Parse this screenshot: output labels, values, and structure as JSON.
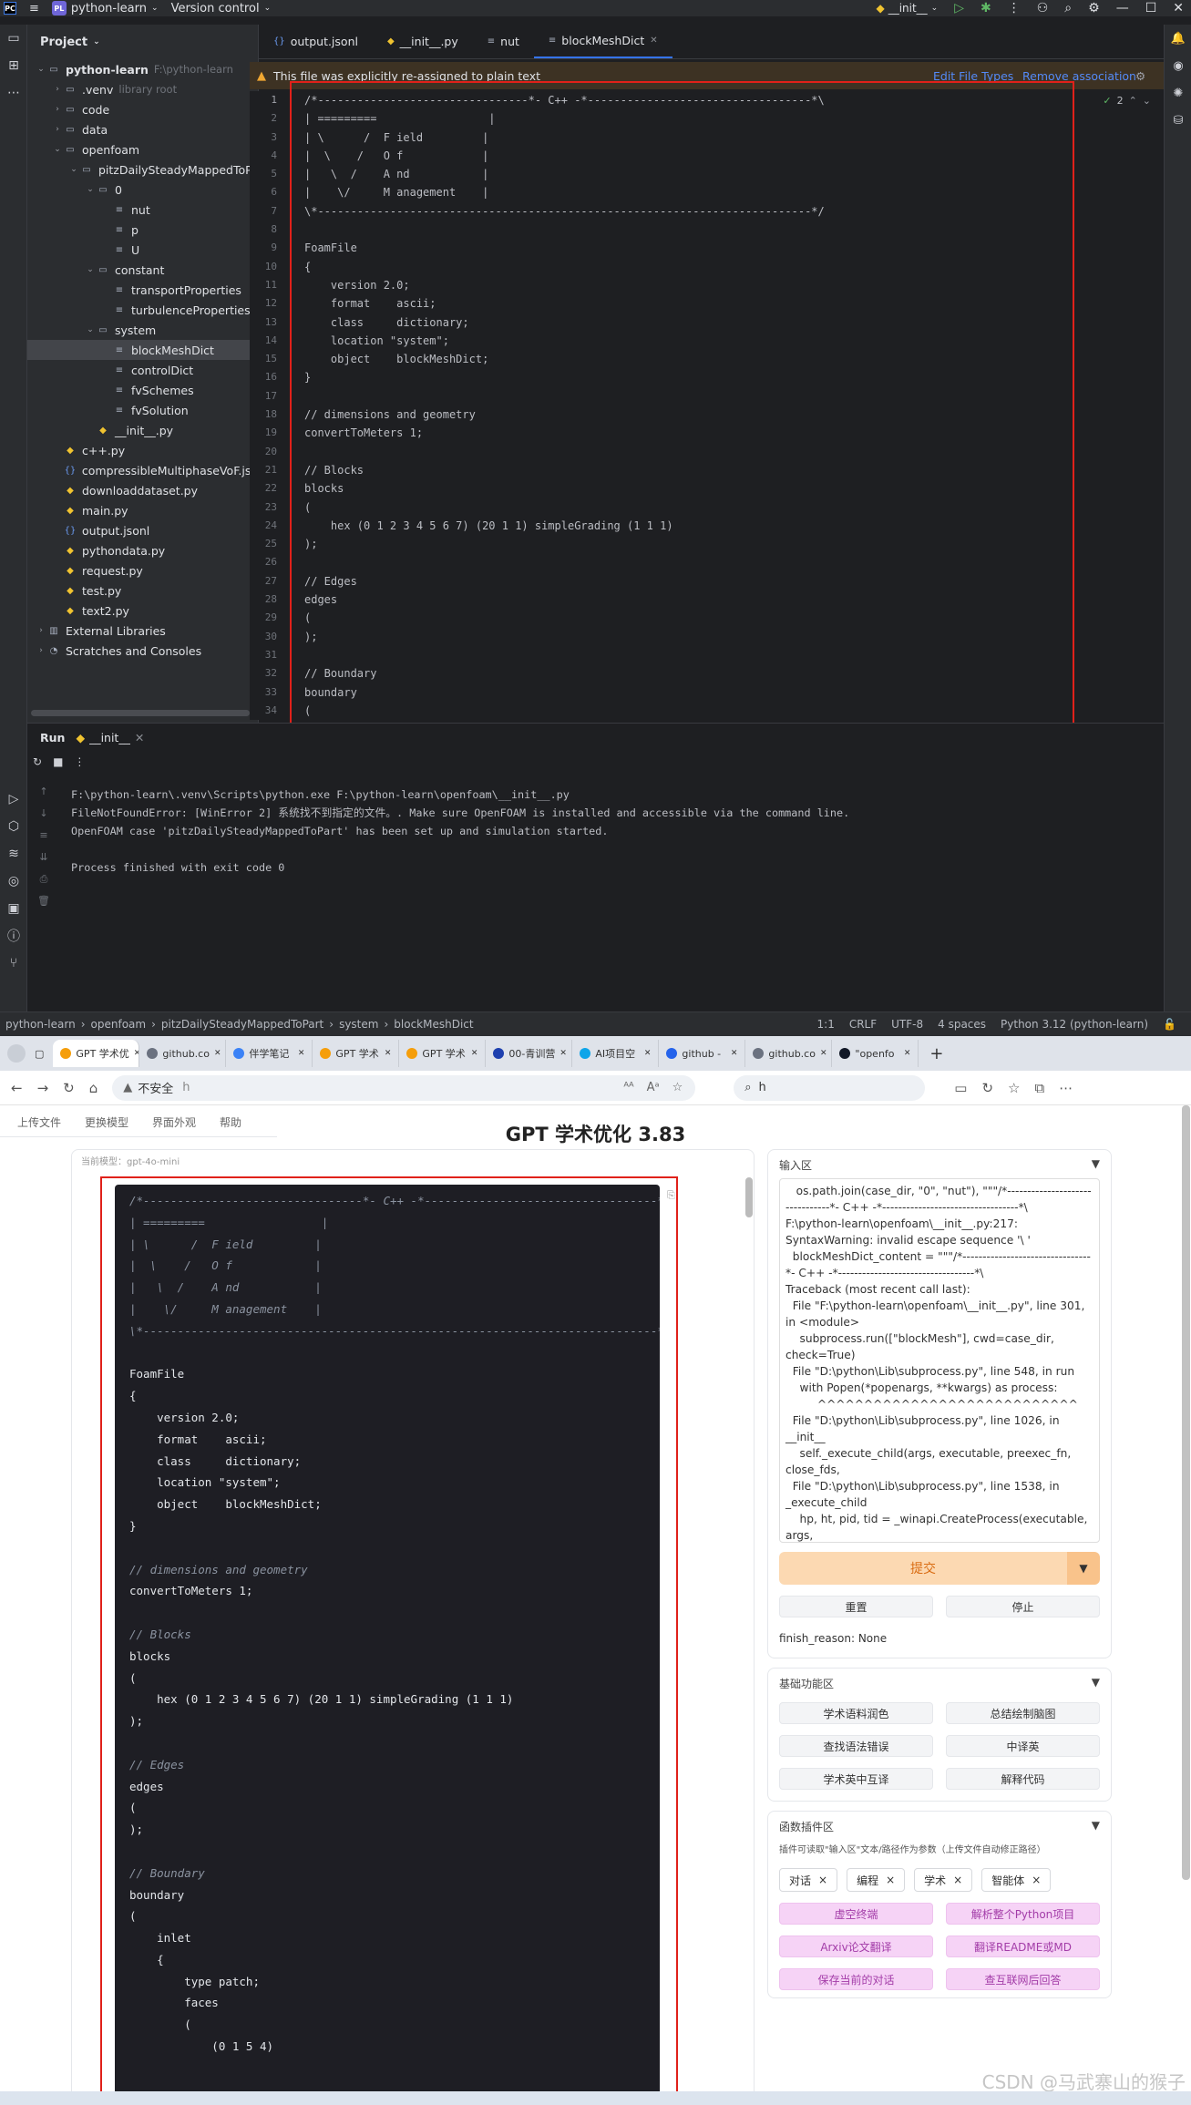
{
  "ide": {
    "title_bar": {
      "project": "python-learn",
      "vcs": "Version control",
      "run_config": "__init__"
    },
    "project_panel": {
      "title": "Project",
      "tree": [
        {
          "label": "python-learn",
          "hint": "F:\\python-learn",
          "depth": 0,
          "type": "folder",
          "open": true,
          "bold": true
        },
        {
          "label": ".venv",
          "hint": "library root",
          "depth": 1,
          "type": "folder",
          "open": false
        },
        {
          "label": "code",
          "hint": "",
          "depth": 1,
          "type": "folder",
          "open": false
        },
        {
          "label": "data",
          "hint": "",
          "depth": 1,
          "type": "folder",
          "open": false
        },
        {
          "label": "openfoam",
          "hint": "",
          "depth": 1,
          "type": "folder",
          "open": true
        },
        {
          "label": "pitzDailySteadyMappedToP",
          "hint": "",
          "depth": 2,
          "type": "folder",
          "open": true
        },
        {
          "label": "0",
          "hint": "",
          "depth": 3,
          "type": "folder",
          "open": true
        },
        {
          "label": "nut",
          "hint": "",
          "depth": 4,
          "type": "text"
        },
        {
          "label": "p",
          "hint": "",
          "depth": 4,
          "type": "text"
        },
        {
          "label": "U",
          "hint": "",
          "depth": 4,
          "type": "text"
        },
        {
          "label": "constant",
          "hint": "",
          "depth": 3,
          "type": "folder",
          "open": true
        },
        {
          "label": "transportProperties",
          "hint": "",
          "depth": 4,
          "type": "text"
        },
        {
          "label": "turbulenceProperties",
          "hint": "",
          "depth": 4,
          "type": "text"
        },
        {
          "label": "system",
          "hint": "",
          "depth": 3,
          "type": "folder",
          "open": true
        },
        {
          "label": "blockMeshDict",
          "hint": "",
          "depth": 4,
          "type": "text",
          "selected": true
        },
        {
          "label": "controlDict",
          "hint": "",
          "depth": 4,
          "type": "text"
        },
        {
          "label": "fvSchemes",
          "hint": "",
          "depth": 4,
          "type": "text"
        },
        {
          "label": "fvSolution",
          "hint": "",
          "depth": 4,
          "type": "text"
        },
        {
          "label": "__init__.py",
          "hint": "",
          "depth": 3,
          "type": "py"
        },
        {
          "label": "c++.py",
          "hint": "",
          "depth": 1,
          "type": "py"
        },
        {
          "label": "compressibleMultiphaseVoF.jso",
          "hint": "",
          "depth": 1,
          "type": "json"
        },
        {
          "label": "downloaddataset.py",
          "hint": "",
          "depth": 1,
          "type": "py"
        },
        {
          "label": "main.py",
          "hint": "",
          "depth": 1,
          "type": "py"
        },
        {
          "label": "output.jsonl",
          "hint": "",
          "depth": 1,
          "type": "json"
        },
        {
          "label": "pythondata.py",
          "hint": "",
          "depth": 1,
          "type": "py"
        },
        {
          "label": "request.py",
          "hint": "",
          "depth": 1,
          "type": "py"
        },
        {
          "label": "test.py",
          "hint": "",
          "depth": 1,
          "type": "py"
        },
        {
          "label": "text2.py",
          "hint": "",
          "depth": 1,
          "type": "py"
        },
        {
          "label": "External Libraries",
          "hint": "",
          "depth": 0,
          "type": "lib",
          "open": false
        },
        {
          "label": "Scratches and Consoles",
          "hint": "",
          "depth": 0,
          "type": "scratch",
          "open": false
        }
      ]
    },
    "editor_tabs": [
      {
        "label": "output.jsonl",
        "icon": "json-icon"
      },
      {
        "label": "__init__.py",
        "icon": "python-icon"
      },
      {
        "label": "nut",
        "icon": "text-file-icon"
      },
      {
        "label": "blockMeshDict",
        "icon": "text-file-icon",
        "active": true,
        "closable": true
      }
    ],
    "notice": {
      "text": "This file was explicitly re-assigned to plain text",
      "action1": "Edit File Types",
      "action2": "Remove association"
    },
    "editor": {
      "inspection_count": "2",
      "lines": [
        "/*--------------------------------*- C++ -*----------------------------------*\\",
        "| =========                 |",
        "| \\      /  F ield         |",
        "|  \\    /   O f            |",
        "|   \\  /    A nd           |",
        "|    \\/     M anagement    |",
        "\\*---------------------------------------------------------------------------*/",
        "",
        "FoamFile",
        "{",
        "    version 2.0;",
        "    format    ascii;",
        "    class     dictionary;",
        "    location \"system\";",
        "    object    blockMeshDict;",
        "}",
        "",
        "// dimensions and geometry",
        "convertToMeters 1;",
        "",
        "// Blocks",
        "blocks",
        "(",
        "    hex (0 1 2 3 4 5 6 7) (20 1 1) simpleGrading (1 1 1)",
        ");",
        "",
        "// Edges",
        "edges",
        "(",
        ");",
        "",
        "// Boundary",
        "boundary",
        "("
      ]
    },
    "run": {
      "tab_label": "Run",
      "config_label": "__init__",
      "output": [
        "F:\\python-learn\\.venv\\Scripts\\python.exe F:\\python-learn\\openfoam\\__init__.py",
        "FileNotFoundError: [WinError 2] 系统找不到指定的文件。. Make sure OpenFOAM is installed and accessible via the command line.",
        "OpenFOAM case 'pitzDailySteadyMappedToPart' has been set up and simulation started.",
        "",
        "Process finished with exit code 0"
      ]
    },
    "status": {
      "breadcrumb": [
        "python-learn",
        "openfoam",
        "pitzDailySteadyMappedToPart",
        "system",
        "blockMeshDict"
      ],
      "position": "1:1",
      "line_sep": "CRLF",
      "encoding": "UTF-8",
      "indent": "4 spaces",
      "interpreter": "Python 3.12 (python-learn)"
    }
  },
  "browser": {
    "tabs": [
      {
        "label": "GPT 学术优",
        "color": "#f59e0b",
        "active": true
      },
      {
        "label": "github.co",
        "color": "#6b7280"
      },
      {
        "label": "伴学笔记",
        "color": "#3b82f6"
      },
      {
        "label": "GPT 学术",
        "color": "#f59e0b"
      },
      {
        "label": "GPT 学术",
        "color": "#f59e0b"
      },
      {
        "label": "00-青训营",
        "color": "#1e40af"
      },
      {
        "label": "AI项目空",
        "color": "#0ea5e9"
      },
      {
        "label": "github - ",
        "color": "#2563eb"
      },
      {
        "label": "github.co",
        "color": "#6b7280"
      },
      {
        "label": "\"openfo",
        "color": "#111827"
      }
    ],
    "address": {
      "security": "不安全",
      "url": "h",
      "search": "h"
    },
    "app": {
      "menu": [
        "上传文件",
        "更换模型",
        "界面外观",
        "帮助"
      ],
      "title": "GPT 学术优化 3.83",
      "model_label": "当前模型：gpt-4o-mini",
      "code_lines": [
        "/*--------------------------------*- C++ -*----------------------------------*\\",
        "| =========                 |",
        "| \\      /  F ield         |",
        "|  \\    /   O f            |",
        "|   \\  /    A nd           |",
        "|    \\/     M anagement    |",
        "\\*---------------------------------------------------------------------------*/",
        "",
        "FoamFile",
        "{",
        "    version 2.0;",
        "    format    ascii;",
        "    class     dictionary;",
        "    location \"system\";",
        "    object    blockMeshDict;",
        "}",
        "",
        "// dimensions and geometry",
        "convertToMeters 1;",
        "",
        "// Blocks",
        "blocks",
        "(",
        "    hex (0 1 2 3 4 5 6 7) (20 1 1) simpleGrading (1 1 1)",
        ");",
        "",
        "// Edges",
        "edges",
        "(",
        ");",
        "",
        "// Boundary",
        "boundary",
        "(",
        "    inlet",
        "    {",
        "        type patch;",
        "        faces",
        "        (",
        "            (0 1 5 4)"
      ],
      "input_title": "输入区",
      "input_lines": [
        "   os.path.join(case_dir, \"0\", \"nut\"), \"\"\"/*--------------------------------*- C++ -*----------------------------------*\\",
        "F:\\python-learn\\openfoam\\__init__.py:217: SyntaxWarning: invalid escape sequence '\\ '",
        "  blockMeshDict_content = \"\"\"/*--------------------------------*- C++ -*----------------------------------*\\",
        "Traceback (most recent call last):",
        "  File \"F:\\python-learn\\openfoam\\__init__.py\", line 301, in <module>",
        "    subprocess.run([\"blockMesh\"], cwd=case_dir, check=True)",
        "  File \"D:\\python\\Lib\\subprocess.py\", line 548, in run",
        "    with Popen(*popenargs, **kwargs) as process:",
        "         ^^^^^^^^^^^^^^^^^^^^^^^^^^^^",
        "  File \"D:\\python\\Lib\\subprocess.py\", line 1026, in __init__",
        "    self._execute_child(args, executable, preexec_fn, close_fds,",
        "  File \"D:\\python\\Lib\\subprocess.py\", line 1538, in _execute_child",
        "    hp, ht, pid, tid = _winapi.CreateProcess(executable, args,",
        "                       ^^^^^^^^^^^^^^^^^^^^^^^^^^^^^^^^^^^^^^^^^",
        "FileNotFoundError: [WinError 2] 系统找不到指定的文件。"
      ],
      "submit_label": "提交",
      "reset_label": "重置",
      "stop_label": "停止",
      "finish_reason": "finish_reason: None",
      "basic_title": "基础功能区",
      "basic_buttons": [
        "学术语料润色",
        "总结绘制脑图",
        "查找语法错误",
        "中译英",
        "学术英中互译",
        "解释代码"
      ],
      "plugin_title": "函数插件区",
      "plugin_hint": "插件可读取\"输入区\"文本/路径作为参数（上传文件自动修正路径）",
      "plugin_chips": [
        "对话",
        "编程",
        "学术",
        "智能体"
      ],
      "plugin_buttons": [
        "虚空终端",
        "解析整个Python项目",
        "Arxiv论文翻译",
        "翻译README或MD",
        "保存当前的对话",
        "查互联网后回答"
      ]
    },
    "watermark": "CSDN @马武寨山的猴子"
  }
}
